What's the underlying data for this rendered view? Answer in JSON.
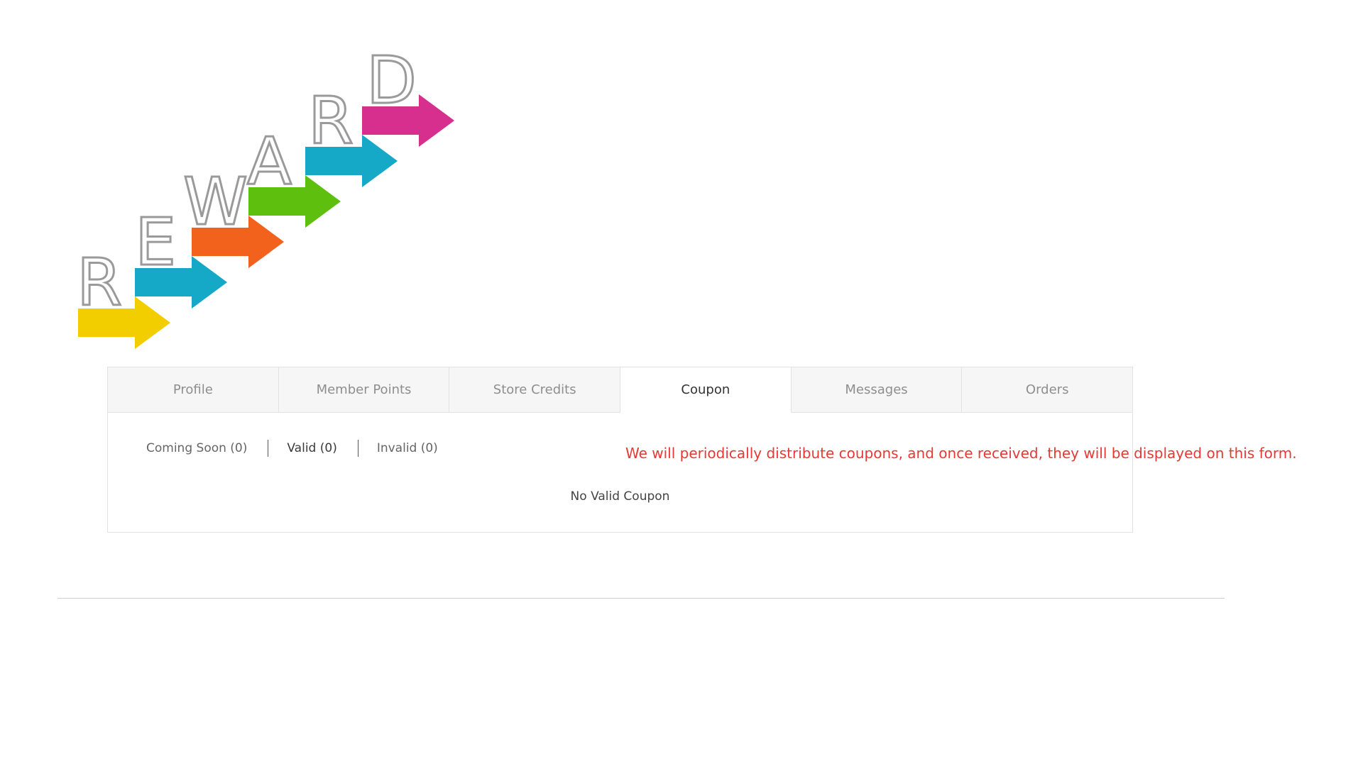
{
  "hero": {
    "word": "REWARD",
    "letters": [
      "R",
      "E",
      "W",
      "A",
      "R",
      "D"
    ],
    "arrow_colors": [
      "#f2cd00",
      "#16a8c7",
      "#f2621c",
      "#5fbf0f",
      "#16a8c7",
      "#d62f8e"
    ]
  },
  "tabs": [
    {
      "label": "Profile"
    },
    {
      "label": "Member Points"
    },
    {
      "label": "Store Credits"
    },
    {
      "label": "Coupon",
      "active": true
    },
    {
      "label": "Messages"
    },
    {
      "label": "Orders"
    }
  ],
  "coupon": {
    "subtabs": [
      {
        "label": "Coming Soon (0)"
      },
      {
        "label": "Valid (0)",
        "active": true
      },
      {
        "label": "Invalid (0)"
      }
    ],
    "empty_message": "No Valid Coupon",
    "notice": "We will periodically distribute coupons, and once received, they will be displayed on this form."
  },
  "colors": {
    "notice": "#e53935",
    "tab_inactive_bg": "#f6f6f6",
    "tab_active_bg": "#ffffff",
    "border": "#e2e2e2"
  }
}
